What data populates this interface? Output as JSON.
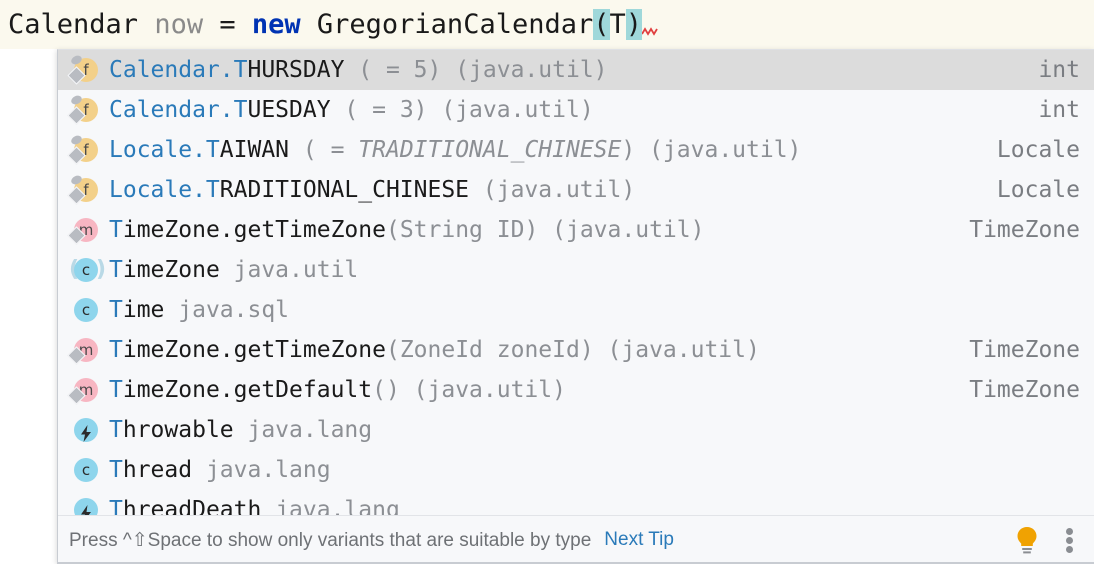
{
  "editor": {
    "tokens": [
      {
        "text": "Calendar ",
        "kind": "plain"
      },
      {
        "text": "now ",
        "kind": "var"
      },
      {
        "text": "= ",
        "kind": "plain"
      },
      {
        "text": "new ",
        "kind": "keyword"
      },
      {
        "text": "GregorianCalendar",
        "kind": "plain"
      },
      {
        "text": "(",
        "kind": "highlight"
      },
      {
        "text": "T",
        "kind": "plain"
      },
      {
        "text": ")",
        "kind": "highlight"
      }
    ],
    "full_line": "Calendar now = new GregorianCalendar(T)",
    "caret_after": "T",
    "error_squiggle": true,
    "background_color": "#fbf9ee",
    "keyword_color": "#0033b3",
    "highlight_color": "#9fd8da"
  },
  "completion": {
    "selected_index": 0,
    "selection_color": "#dcdcdc",
    "match_color": "#2a7ab9",
    "items": [
      {
        "icon": "field-static-icon",
        "icon_kind": "field",
        "match": "Calendar.T",
        "main": "HURSDAY",
        "tail": " ( = 5) (java.util)",
        "tail_italic": "",
        "tail_after": "",
        "type": "int",
        "selected": true
      },
      {
        "icon": "field-static-icon",
        "icon_kind": "field",
        "match": "Calendar.T",
        "main": "UESDAY",
        "tail": " ( = 3) (java.util)",
        "tail_italic": "",
        "tail_after": "",
        "type": "int",
        "selected": false
      },
      {
        "icon": "field-static-icon",
        "icon_kind": "field",
        "match": "Locale.T",
        "main": "AIWAN",
        "tail": " ( = ",
        "tail_italic": "TRADITIONAL_CHINESE",
        "tail_after": ") (java.util)",
        "type": "Locale",
        "selected": false
      },
      {
        "icon": "field-static-icon",
        "icon_kind": "field",
        "match": "Locale.T",
        "main": "RADITIONAL_CHINESE",
        "tail": " (java.util)",
        "tail_italic": "",
        "tail_after": "",
        "type": "Locale",
        "selected": false
      },
      {
        "icon": "method-static-icon",
        "icon_kind": "method",
        "match": "T",
        "main": "imeZone.getTimeZone",
        "tail": "(String ID) (java.util)",
        "tail_italic": "",
        "tail_after": "",
        "type": "TimeZone",
        "selected": false
      },
      {
        "icon": "abstract-class-icon",
        "icon_kind": "abstract-class",
        "match": "T",
        "main": "imeZone",
        "tail": " java.util",
        "tail_italic": "",
        "tail_after": "",
        "type": "",
        "selected": false
      },
      {
        "icon": "class-icon",
        "icon_kind": "class",
        "match": "T",
        "main": "ime",
        "tail": " java.sql",
        "tail_italic": "",
        "tail_after": "",
        "type": "",
        "selected": false
      },
      {
        "icon": "method-static-icon",
        "icon_kind": "method",
        "match": "T",
        "main": "imeZone.getTimeZone",
        "tail": "(ZoneId zoneId) (java.util)",
        "tail_italic": "",
        "tail_after": "",
        "type": "TimeZone",
        "selected": false
      },
      {
        "icon": "method-static-icon",
        "icon_kind": "method",
        "match": "T",
        "main": "imeZone.getDefault",
        "tail": "() (java.util)",
        "tail_italic": "",
        "tail_after": "",
        "type": "TimeZone",
        "selected": false
      },
      {
        "icon": "exception-class-icon",
        "icon_kind": "exception",
        "match": "T",
        "main": "hrowable",
        "tail": " java.lang",
        "tail_italic": "",
        "tail_after": "",
        "type": "",
        "selected": false
      },
      {
        "icon": "class-icon",
        "icon_kind": "class",
        "match": "T",
        "main": "hread",
        "tail": " java.lang",
        "tail_italic": "",
        "tail_after": "",
        "type": "",
        "selected": false
      },
      {
        "icon": "exception-class-icon",
        "icon_kind": "exception",
        "match": "T",
        "main": "hreadDeath",
        "tail": " java.lang",
        "tail_italic": "",
        "tail_after": "",
        "type": "",
        "selected": false
      }
    ]
  },
  "status": {
    "hint_text": "Press ^⇧Space to show only variants that are suitable by type",
    "next_tip_label": "Next Tip",
    "bulb_icon": "lightbulb-icon",
    "bulb_color": "#f0a202",
    "menu_icon": "kebab-menu-icon"
  }
}
